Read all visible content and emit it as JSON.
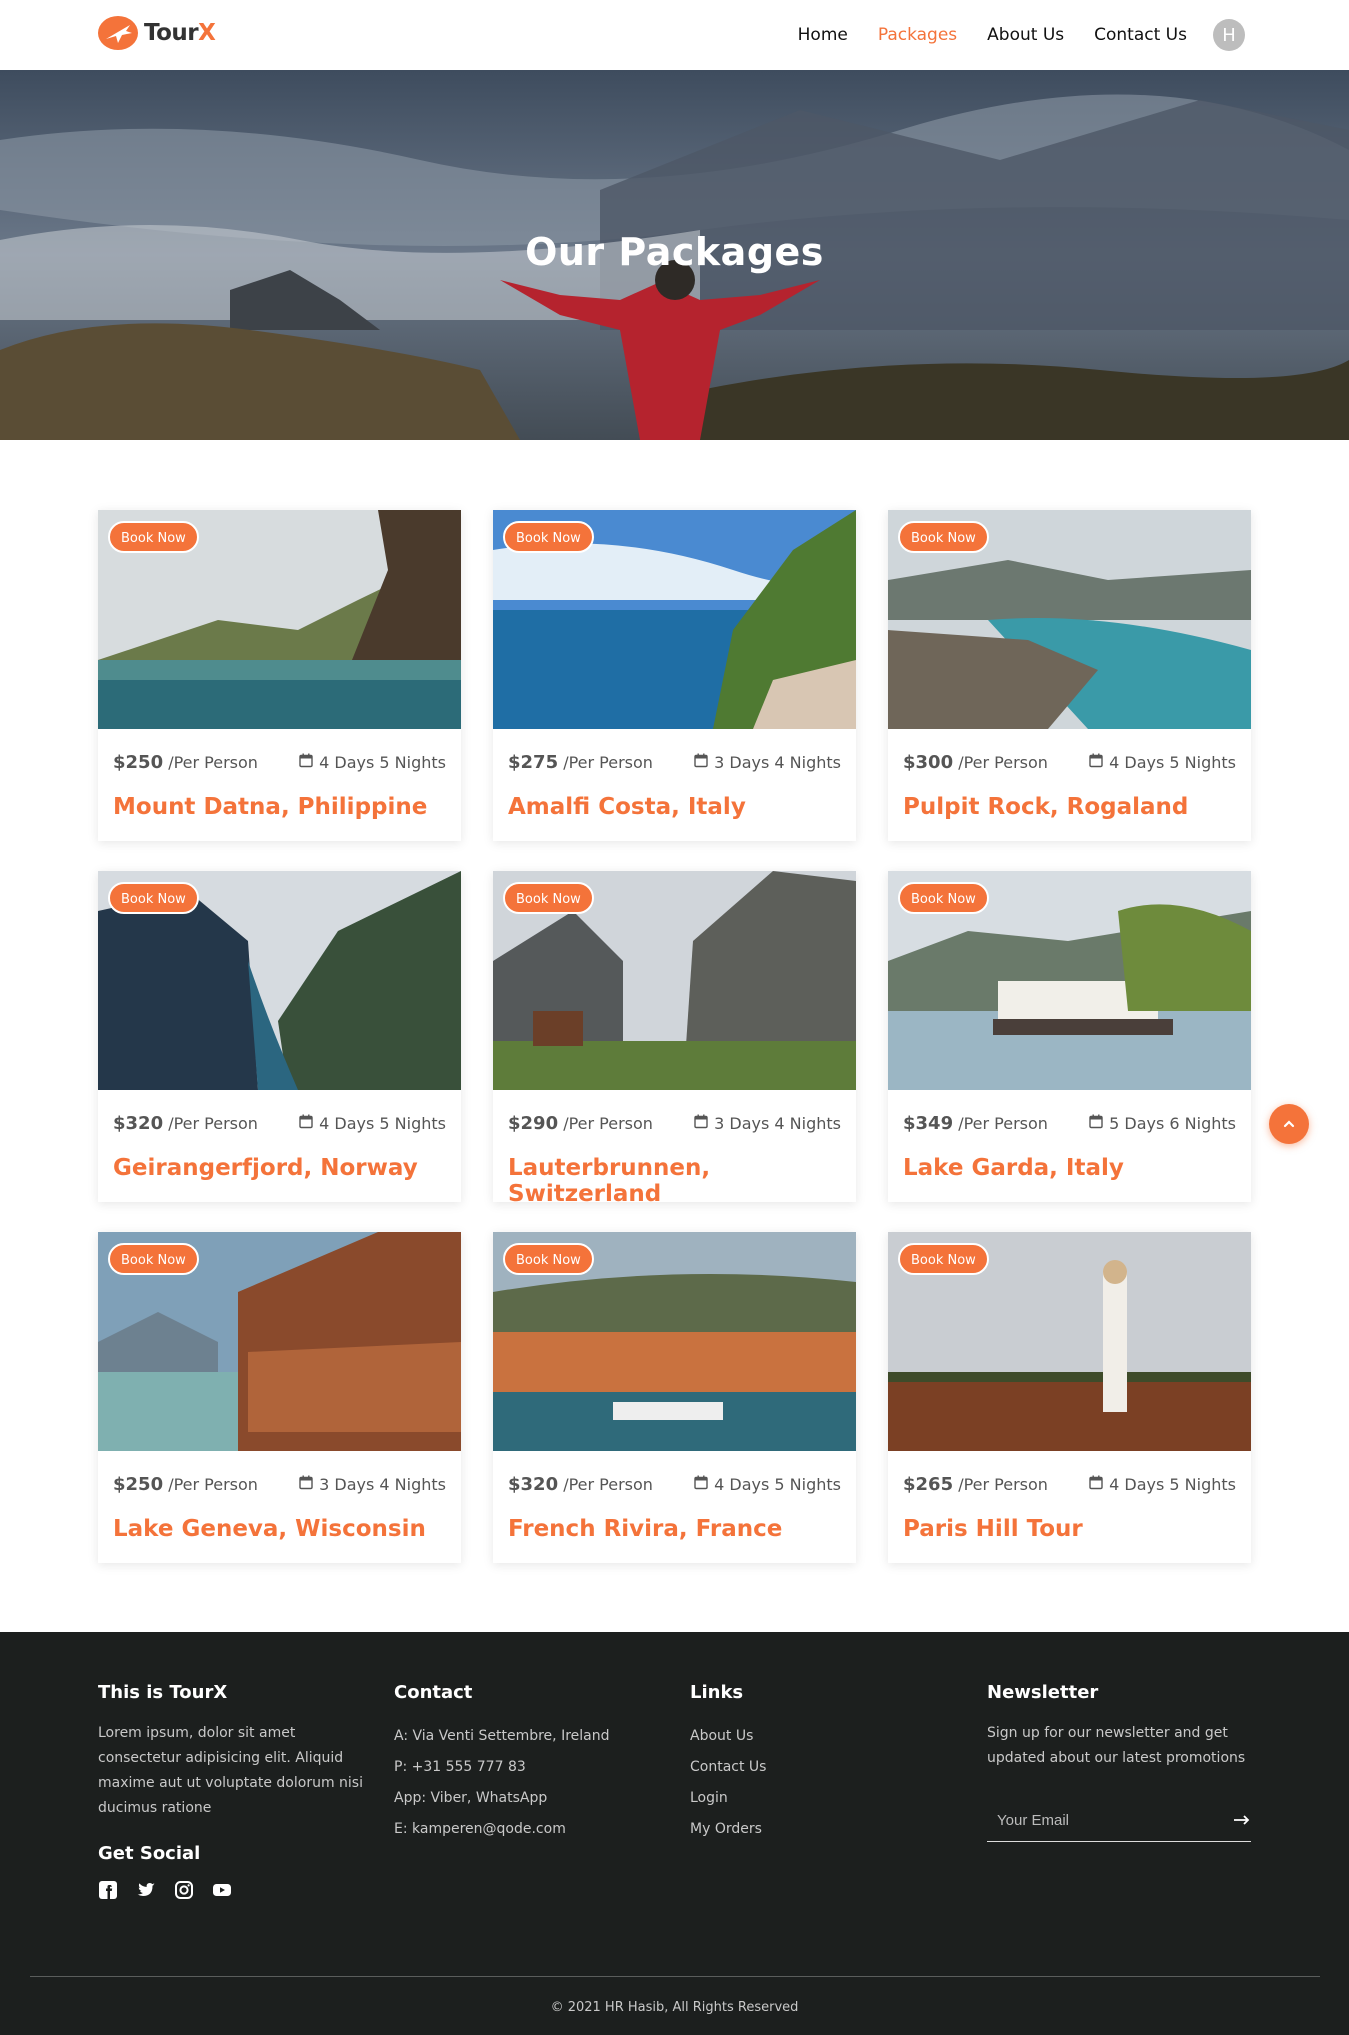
{
  "nav": {
    "brand_prefix": "Tour",
    "brand_suffix": "X",
    "links": [
      "Home",
      "Packages",
      "About Us",
      "Contact Us"
    ],
    "active": "Packages",
    "avatar_letter": "H"
  },
  "hero": {
    "title": "Our Packages"
  },
  "packages": [
    {
      "price": "$250",
      "per": "/Per Person",
      "duration": "4 Days 5 Nights",
      "title": "Mount Datna, Philippine",
      "cta": "Book Now"
    },
    {
      "price": "$275",
      "per": "/Per Person",
      "duration": "3 Days 4 Nights",
      "title": "Amalfi Costa, Italy",
      "cta": "Book Now"
    },
    {
      "price": "$300",
      "per": "/Per Person",
      "duration": "4 Days 5 Nights",
      "title": "Pulpit Rock, Rogaland",
      "cta": "Book Now"
    },
    {
      "price": "$320",
      "per": "/Per Person",
      "duration": "4 Days 5 Nights",
      "title": "Geirangerfjord, Norway",
      "cta": "Book Now"
    },
    {
      "price": "$290",
      "per": "/Per Person",
      "duration": "3 Days 4 Nights",
      "title": "Lauterbrunnen, Switzerland",
      "cta": "Book Now"
    },
    {
      "price": "$349",
      "per": "/Per Person",
      "duration": "5 Days 6 Nights",
      "title": "Lake Garda, Italy",
      "cta": "Book Now"
    },
    {
      "price": "$250",
      "per": "/Per Person",
      "duration": "3 Days 4 Nights",
      "title": "Lake Geneva, Wisconsin",
      "cta": "Book Now"
    },
    {
      "price": "$320",
      "per": "/Per Person",
      "duration": "4 Days 5 Nights",
      "title": "French Rivira, France",
      "cta": "Book Now"
    },
    {
      "price": "$265",
      "per": "/Per Person",
      "duration": "4 Days 5 Nights",
      "title": "Paris Hill Tour",
      "cta": "Book Now"
    }
  ],
  "footer": {
    "about": {
      "heading": "This is TourX",
      "text": "Lorem ipsum, dolor sit amet consectetur adipisicing elit. Aliquid maxime aut ut voluptate dolorum nisi ducimus ratione"
    },
    "social_heading": "Get Social",
    "social_icons": [
      "facebook-icon",
      "twitter-icon",
      "instagram-icon",
      "youtube-icon"
    ],
    "contact": {
      "heading": "Contact",
      "lines": [
        "A: Via Venti Settembre, Ireland",
        "P: +31 555 777 83",
        "App: Viber, WhatsApp",
        "E: kamperen@qode.com"
      ]
    },
    "links": {
      "heading": "Links",
      "items": [
        "About Us",
        "Contact Us",
        "Login",
        "My Orders"
      ]
    },
    "newsletter": {
      "heading": "Newsletter",
      "text": "Sign up for our newsletter and get updated about our latest promotions",
      "placeholder": "Your Email"
    },
    "copyright": "© 2021 HR Hasib, All Rights Reserved"
  },
  "colors": {
    "accent": "#f4733a",
    "footer_bg": "#1c1f1e"
  }
}
